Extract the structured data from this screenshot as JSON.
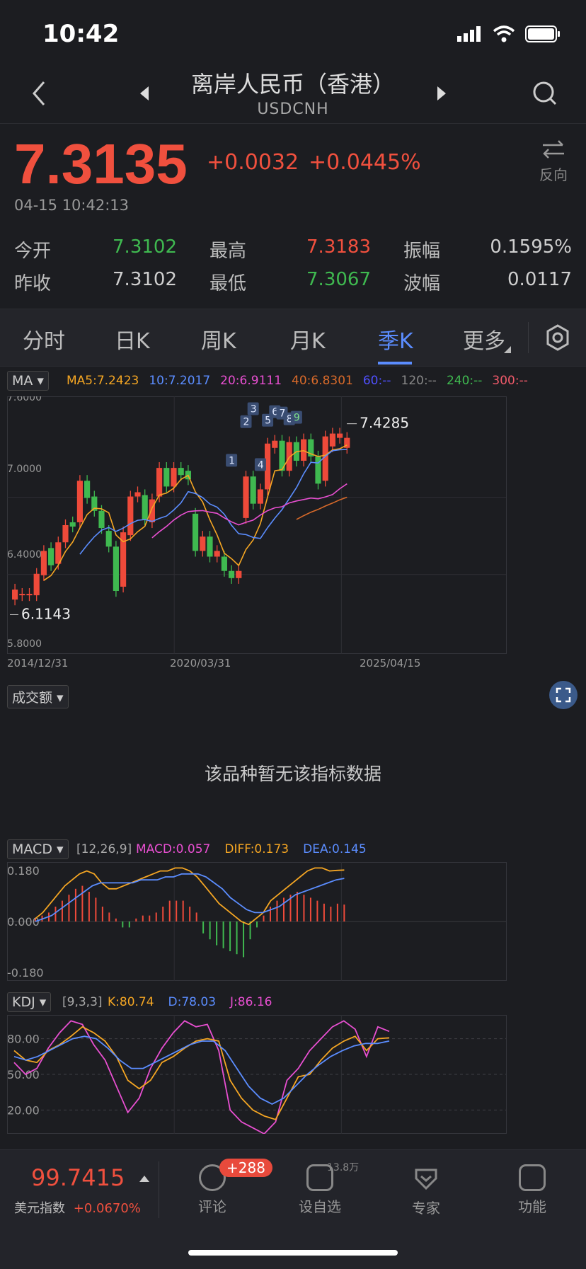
{
  "status": {
    "time": "10:42"
  },
  "header": {
    "title": "离岸人民币（香港）",
    "symbol": "USDCNH"
  },
  "quote": {
    "price": "7.3135",
    "change": "+0.0032",
    "change_pct": "+0.0445%",
    "timestamp": "04-15 10:42:13",
    "reverse_label": "反向"
  },
  "stats": [
    {
      "label": "今开",
      "value": "7.3102",
      "color": "#3fb950"
    },
    {
      "label": "最高",
      "value": "7.3183",
      "color": "#f0503e"
    },
    {
      "label": "振幅",
      "value": "0.1595%",
      "color": "#cfcfcf"
    },
    {
      "label": "昨收",
      "value": "7.3102",
      "color": "#cfcfcf"
    },
    {
      "label": "最低",
      "value": "7.3067",
      "color": "#3fb950"
    },
    {
      "label": "波幅",
      "value": "0.0117",
      "color": "#cfcfcf"
    }
  ],
  "tabs": [
    {
      "label": "分时"
    },
    {
      "label": "日K"
    },
    {
      "label": "周K"
    },
    {
      "label": "月K"
    },
    {
      "label": "季K",
      "active": true
    },
    {
      "label": "更多"
    }
  ],
  "ma": {
    "selector": "MA",
    "legend": [
      {
        "text": "MA5:7.2423",
        "color": "#f5a623"
      },
      {
        "text": "10:7.2017",
        "color": "#5b8dff"
      },
      {
        "text": "20:6.9111",
        "color": "#e84fd1"
      },
      {
        "text": "40:6.8301",
        "color": "#d86a2a"
      },
      {
        "text": "60:--",
        "color": "#5050ff"
      },
      {
        "text": "120:--",
        "color": "#888888"
      },
      {
        "text": "240:--",
        "color": "#3fb950"
      },
      {
        "text": "300:--",
        "color": "#f05a6a"
      }
    ],
    "yticks": [
      "7.6000",
      "7.0000",
      "6.4000",
      "5.8000"
    ],
    "xticks": [
      "2014/12/31",
      "2020/03/31",
      "2025/04/15"
    ],
    "max_label": "7.4285",
    "min_label": "6.1143"
  },
  "volume": {
    "selector": "成交额",
    "empty_msg": "该品种暂无该指标数据"
  },
  "macd": {
    "selector": "MACD",
    "params": "[12,26,9]",
    "legend": [
      {
        "text": "MACD:0.057",
        "color": "#e84fd1"
      },
      {
        "text": "DIFF:0.173",
        "color": "#f5a623"
      },
      {
        "text": "DEA:0.145",
        "color": "#5b8dff"
      }
    ],
    "yticks": [
      "0.180",
      "0.000",
      "-0.180"
    ]
  },
  "kdj": {
    "selector": "KDJ",
    "params": "[9,3,3]",
    "legend": [
      {
        "text": "K:80.74",
        "color": "#f5a623"
      },
      {
        "text": "D:78.03",
        "color": "#5b8dff"
      },
      {
        "text": "J:86.16",
        "color": "#e84fd1"
      }
    ],
    "yticks": [
      "80.00",
      "50.00",
      "20.00"
    ]
  },
  "chart_data": [
    {
      "type": "candlestick",
      "series": [
        {
          "name": "MA5"
        },
        {
          "name": "10"
        },
        {
          "name": "20"
        },
        {
          "name": "40"
        }
      ],
      "ylim": [
        5.8,
        7.6
      ],
      "xticks": [
        "2014/12/31",
        "2020/03/31",
        "2025/04/15"
      ],
      "candles": [
        {
          "o": 6.18,
          "c": 6.25
        },
        {
          "o": 6.21,
          "c": 6.22
        },
        {
          "o": 6.21,
          "c": 6.22
        },
        {
          "o": 6.21,
          "c": 6.36
        },
        {
          "o": 6.35,
          "c": 6.52
        },
        {
          "o": 6.54,
          "c": 6.42
        },
        {
          "o": 6.43,
          "c": 6.58
        },
        {
          "o": 6.58,
          "c": 6.7
        },
        {
          "o": 6.72,
          "c": 6.69
        },
        {
          "o": 6.72,
          "c": 7.01
        },
        {
          "o": 7.01,
          "c": 6.89
        },
        {
          "o": 6.9,
          "c": 6.8
        },
        {
          "o": 6.8,
          "c": 6.68
        },
        {
          "o": 6.66,
          "c": 6.55
        },
        {
          "o": 6.55,
          "c": 6.24
        },
        {
          "o": 6.27,
          "c": 6.65
        },
        {
          "o": 6.63,
          "c": 6.9
        },
        {
          "o": 6.9,
          "c": 6.93
        },
        {
          "o": 6.91,
          "c": 6.74
        },
        {
          "o": 6.72,
          "c": 6.88
        },
        {
          "o": 6.9,
          "c": 7.1
        },
        {
          "o": 7.1,
          "c": 6.97
        },
        {
          "o": 6.97,
          "c": 7.1
        },
        {
          "o": 7.1,
          "c": 7.05
        },
        {
          "o": 7.08,
          "c": 7.02
        },
        {
          "o": 6.78,
          "c": 6.52
        },
        {
          "o": 6.52,
          "c": 6.62
        },
        {
          "o": 6.62,
          "c": 6.48
        },
        {
          "o": 6.48,
          "c": 6.52
        },
        {
          "o": 6.48,
          "c": 6.38
        },
        {
          "o": 6.38,
          "c": 6.33
        },
        {
          "o": 6.33,
          "c": 6.38
        },
        {
          "o": 6.75,
          "c": 7.04
        },
        {
          "o": 7.04,
          "c": 6.85
        },
        {
          "o": 6.85,
          "c": 6.95
        },
        {
          "o": 6.95,
          "c": 7.27
        },
        {
          "o": 7.24,
          "c": 7.29
        },
        {
          "o": 7.29,
          "c": 7.08
        },
        {
          "o": 7.08,
          "c": 7.28
        },
        {
          "o": 7.28,
          "c": 7.15
        },
        {
          "o": 7.15,
          "c": 7.3
        },
        {
          "o": 7.3,
          "c": 7.18
        },
        {
          "o": 7.18,
          "c": 6.99
        },
        {
          "o": 7.01,
          "c": 7.32
        },
        {
          "o": 7.25,
          "c": 7.34
        },
        {
          "o": 7.31,
          "c": 7.34
        },
        {
          "o": 7.24,
          "c": 7.31
        }
      ],
      "max": 7.4285,
      "min": 6.1143,
      "markers": [
        "1",
        "2",
        "3",
        "4",
        "5",
        "6",
        "7",
        "8",
        "9"
      ]
    },
    {
      "type": "bar",
      "name": "MACD",
      "ylim": [
        -0.2,
        0.2
      ],
      "values": [
        0.01,
        0.02,
        0.03,
        0.05,
        0.07,
        0.09,
        0.11,
        0.12,
        0.1,
        0.08,
        0.05,
        0.03,
        0.01,
        -0.02,
        -0.02,
        0.01,
        0.02,
        0.02,
        0.03,
        0.05,
        0.07,
        0.07,
        0.07,
        0.05,
        0.03,
        -0.04,
        -0.06,
        -0.08,
        -0.09,
        -0.1,
        -0.11,
        -0.12,
        -0.06,
        -0.02,
        0.02,
        0.05,
        0.07,
        0.08,
        0.09,
        0.1,
        0.09,
        0.08,
        0.07,
        0.06,
        0.05,
        0.06,
        0.057
      ],
      "diff": [
        0.01,
        0.03,
        0.06,
        0.09,
        0.12,
        0.14,
        0.16,
        0.17,
        0.16,
        0.13,
        0.11,
        0.11,
        0.12,
        0.13,
        0.14,
        0.15,
        0.16,
        0.17,
        0.17,
        0.18,
        0.18,
        0.17,
        0.15,
        0.12,
        0.09,
        0.06,
        0.04,
        0.02,
        0.0,
        -0.01,
        0.01,
        0.03,
        0.07,
        0.09,
        0.11,
        0.13,
        0.15,
        0.17,
        0.18,
        0.18,
        0.17,
        0.172,
        0.173
      ],
      "dea": [
        0.0,
        0.01,
        0.02,
        0.04,
        0.06,
        0.08,
        0.1,
        0.12,
        0.13,
        0.13,
        0.13,
        0.13,
        0.13,
        0.14,
        0.14,
        0.14,
        0.15,
        0.15,
        0.16,
        0.16,
        0.16,
        0.15,
        0.13,
        0.11,
        0.08,
        0.06,
        0.04,
        0.03,
        0.03,
        0.04,
        0.05,
        0.07,
        0.09,
        0.1,
        0.11,
        0.12,
        0.13,
        0.14,
        0.145
      ]
    },
    {
      "type": "line",
      "name": "KDJ",
      "ylim": [
        0,
        100
      ],
      "k": [
        70,
        62,
        60,
        70,
        75,
        82,
        90,
        85,
        78,
        65,
        45,
        38,
        45,
        60,
        65,
        72,
        78,
        80,
        78,
        45,
        30,
        20,
        15,
        12,
        30,
        48,
        50,
        62,
        72,
        78,
        82,
        70,
        80,
        80.74
      ],
      "d": [
        65,
        62,
        65,
        70,
        75,
        80,
        82,
        80,
        72,
        62,
        55,
        55,
        60,
        65,
        70,
        75,
        78,
        78,
        70,
        55,
        40,
        30,
        25,
        30,
        40,
        50,
        58,
        65,
        70,
        74,
        76,
        76,
        78.03
      ],
      "j": [
        60,
        50,
        55,
        72,
        85,
        95,
        92,
        75,
        62,
        40,
        18,
        30,
        55,
        72,
        85,
        95,
        90,
        92,
        70,
        20,
        10,
        5,
        0,
        10,
        45,
        55,
        70,
        80,
        90,
        95,
        88,
        65,
        90,
        86.16
      ]
    }
  ],
  "bottom": {
    "index_value": "99.7415",
    "index_name": "美元指数",
    "index_change": "+0.0670%",
    "items": [
      {
        "label": "评论",
        "badge": "+288"
      },
      {
        "label": "设自选",
        "badge": "13.8万"
      },
      {
        "label": "专家"
      },
      {
        "label": "功能"
      }
    ]
  }
}
